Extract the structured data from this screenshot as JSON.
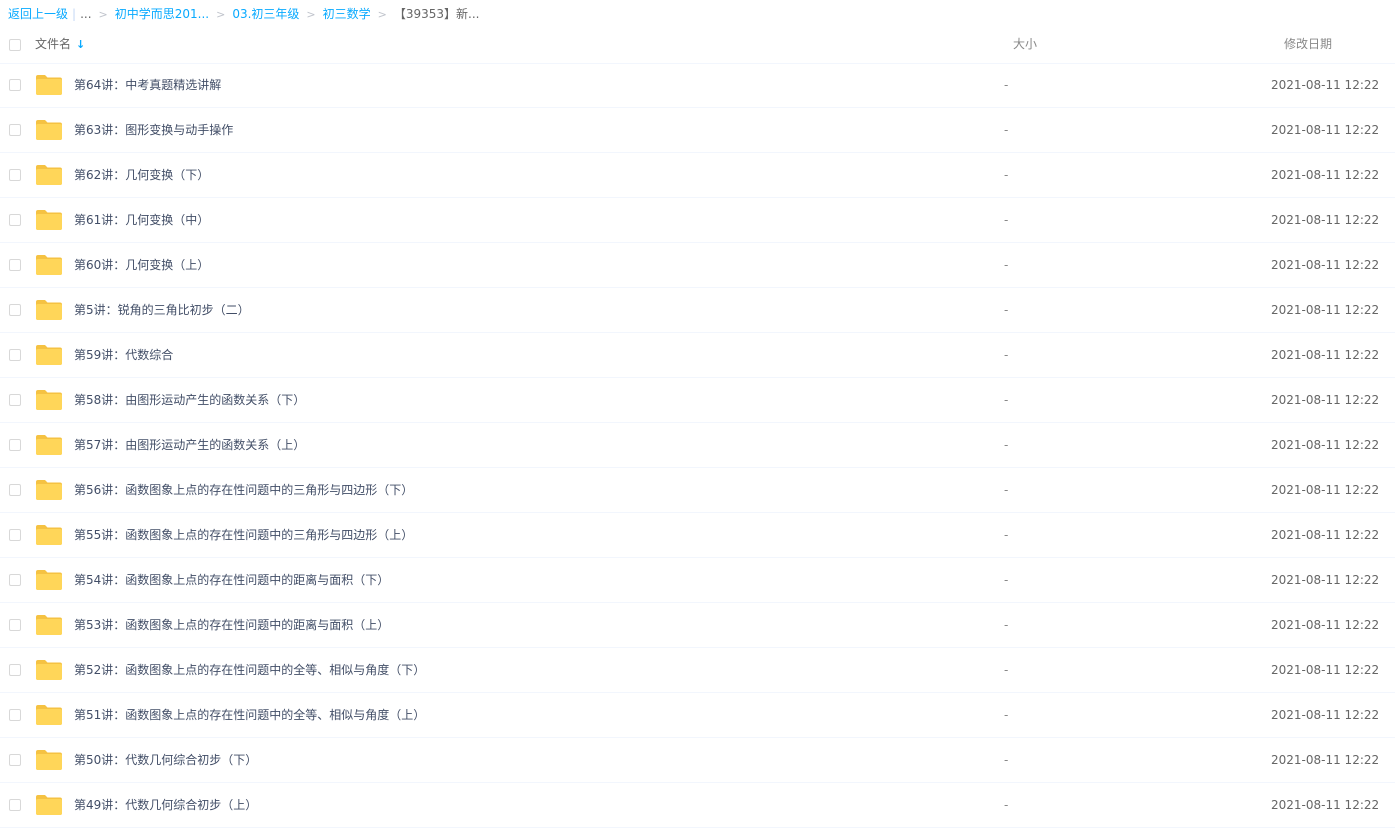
{
  "breadcrumb": {
    "back_label": "返回上一级",
    "ellipsis": "...",
    "items": [
      "初中学而思201...",
      "03.初三年级",
      "初三数学"
    ],
    "current": "【39353】新..."
  },
  "table": {
    "columns": {
      "name": "文件名",
      "size": "大小",
      "date": "修改日期"
    },
    "sort_icon": "arrow-down-icon",
    "rows": [
      {
        "name": "第64讲：中考真题精选讲解",
        "size": "-",
        "date": "2021-08-11 12:22"
      },
      {
        "name": "第63讲：图形变换与动手操作",
        "size": "-",
        "date": "2021-08-11 12:22"
      },
      {
        "name": "第62讲：几何变换（下）",
        "size": "-",
        "date": "2021-08-11 12:22"
      },
      {
        "name": "第61讲：几何变换（中）",
        "size": "-",
        "date": "2021-08-11 12:22"
      },
      {
        "name": "第60讲：几何变换（上）",
        "size": "-",
        "date": "2021-08-11 12:22"
      },
      {
        "name": "第5讲：锐角的三角比初步（二）",
        "size": "-",
        "date": "2021-08-11 12:22"
      },
      {
        "name": "第59讲：代数综合",
        "size": "-",
        "date": "2021-08-11 12:22"
      },
      {
        "name": "第58讲：由图形运动产生的函数关系（下）",
        "size": "-",
        "date": "2021-08-11 12:22"
      },
      {
        "name": "第57讲：由图形运动产生的函数关系（上）",
        "size": "-",
        "date": "2021-08-11 12:22"
      },
      {
        "name": "第56讲：函数图象上点的存在性问题中的三角形与四边形（下）",
        "size": "-",
        "date": "2021-08-11 12:22"
      },
      {
        "name": "第55讲：函数图象上点的存在性问题中的三角形与四边形（上）",
        "size": "-",
        "date": "2021-08-11 12:22"
      },
      {
        "name": "第54讲：函数图象上点的存在性问题中的距离与面积（下）",
        "size": "-",
        "date": "2021-08-11 12:22"
      },
      {
        "name": "第53讲：函数图象上点的存在性问题中的距离与面积（上）",
        "size": "-",
        "date": "2021-08-11 12:22"
      },
      {
        "name": "第52讲：函数图象上点的存在性问题中的全等、相似与角度（下）",
        "size": "-",
        "date": "2021-08-11 12:22"
      },
      {
        "name": "第51讲：函数图象上点的存在性问题中的全等、相似与角度（上）",
        "size": "-",
        "date": "2021-08-11 12:22"
      },
      {
        "name": "第50讲：代数几何综合初步（下）",
        "size": "-",
        "date": "2021-08-11 12:22"
      },
      {
        "name": "第49讲：代数几何综合初步（上）",
        "size": "-",
        "date": "2021-08-11 12:22"
      }
    ]
  },
  "colors": {
    "link": "#09aaff",
    "folder": "#ffd659",
    "folder_dark": "#f5c242",
    "divider": "#f2f6fd"
  }
}
